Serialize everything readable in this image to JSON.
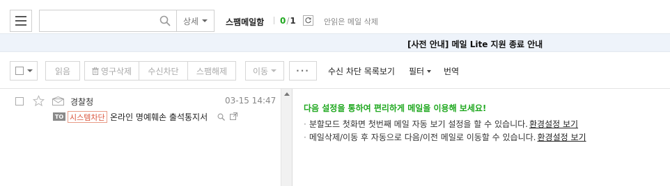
{
  "header": {
    "search": {
      "value": "",
      "placeholder": ""
    },
    "detail_label": "상세",
    "folder_title": "스팸메일함",
    "unread_count": "0",
    "count_separator": "/",
    "total_count": "1",
    "delete_unread_label": "안읽은 메일 삭제"
  },
  "notice": {
    "text": "[사전 안내] 메일 Lite 지원 종료 안내"
  },
  "toolbar": {
    "read_label": "읽음",
    "delete_forever_label": "영구삭제",
    "block_sender_label": "수신차단",
    "unspam_label": "스팸해제",
    "move_label": "이동",
    "more_label": "···",
    "blocklist_label": "수신 차단 목록보기",
    "filter_label": "필터",
    "translate_label": "번역"
  },
  "mails": [
    {
      "sender": "경찰청",
      "date": "03-15 14:47",
      "to_badge": "TO",
      "tag": "시스템차단",
      "subject": "온라인 명예훼손 출석통지서"
    }
  ],
  "reading_pane": {
    "title": "다음 설정을 통하여 편리하게 메일을 이용해 보세요!",
    "items": [
      {
        "text": "분할모드 첫화면 첫번째 메일 자동 보기 설정을 할 수 있습니다.",
        "link": "환경설정 보기"
      },
      {
        "text": "메일삭제/이동 후 자동으로 다음/이전 메일로 이동할 수 있습니다.",
        "link": "환경설정 보기"
      }
    ]
  },
  "colors": {
    "accent_green": "#1fa81f",
    "notice_bg": "#eef3fa",
    "tag_red": "#d9533a"
  },
  "icons": [
    "menu-icon",
    "search-icon",
    "refresh-icon",
    "trash-icon",
    "star-icon",
    "envelope-icon",
    "zoom-icon",
    "popout-icon"
  ]
}
